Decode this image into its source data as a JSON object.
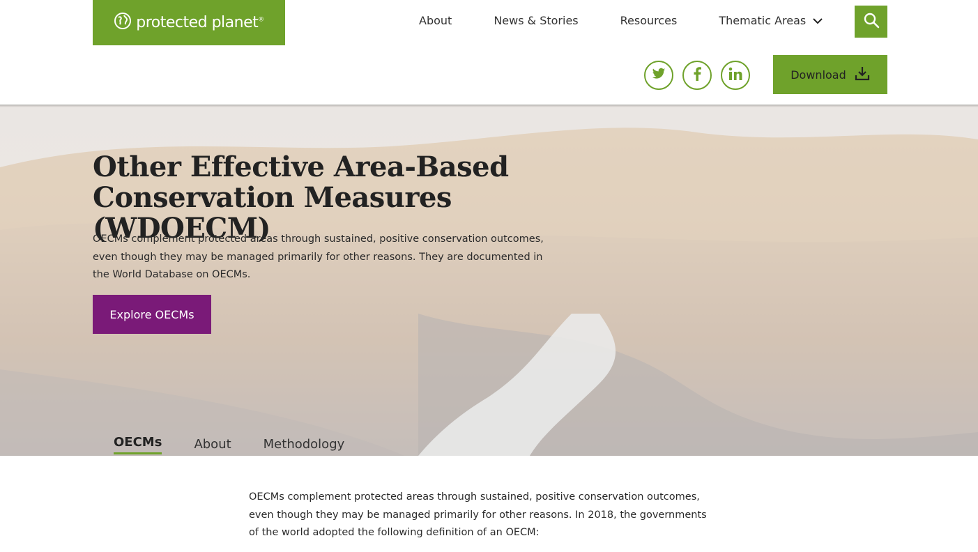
{
  "header": {
    "logo": {
      "text": "protected planet",
      "mark": "®",
      "icon": "globe-icon"
    },
    "nav": [
      {
        "label": "About"
      },
      {
        "label": "News & Stories"
      },
      {
        "label": "Resources"
      },
      {
        "label": "Thematic Areas",
        "icon": "chevron-down-icon"
      }
    ],
    "search": {
      "icon": "search-icon"
    },
    "social": [
      {
        "name": "twitter",
        "icon": "twitter-icon"
      },
      {
        "name": "facebook",
        "icon": "facebook-icon"
      },
      {
        "name": "linkedin",
        "icon": "linkedin-icon"
      }
    ],
    "download": {
      "label": "Download",
      "icon": "download-icon"
    }
  },
  "hero": {
    "title_line1": "Other Effective Area-Based",
    "title_line2": "Conservation Measures (WDOECM)",
    "description": "OECMs complement protected areas through sustained, positive conservation outcomes, even though they may be managed primarily for other reasons. They are documented in the World Database on OECMs.",
    "cta": "Explore OECMs",
    "tabs": [
      {
        "label": "OECMs",
        "active": true
      },
      {
        "label": "About",
        "active": false
      },
      {
        "label": "Methodology",
        "active": false
      }
    ]
  },
  "content": {
    "intro": "OECMs complement protected areas through sustained, positive conservation outcomes, even though they may be managed primarily for other reasons. In 2018, the governments of the world adopted the following definition of an OECM:"
  },
  "colors": {
    "brand_green": "#6fa22b",
    "cta_purple": "#7a1a78"
  }
}
